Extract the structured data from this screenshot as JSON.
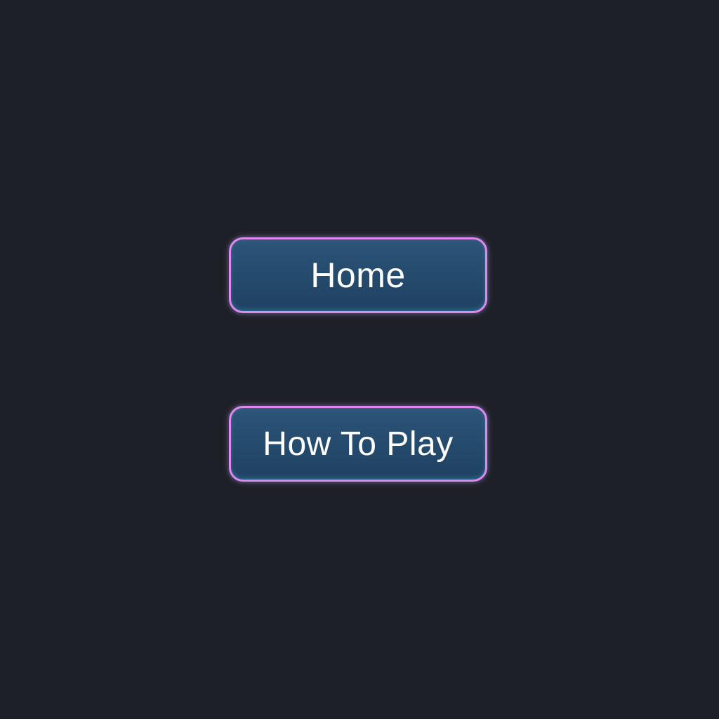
{
  "menu": {
    "buttons": [
      {
        "label": "Home"
      },
      {
        "label": "How To Play"
      }
    ]
  },
  "colors": {
    "background": "#1d2026",
    "button_fill": "#244a6c",
    "button_border": "#e187f0",
    "button_text": "#ffffff"
  }
}
